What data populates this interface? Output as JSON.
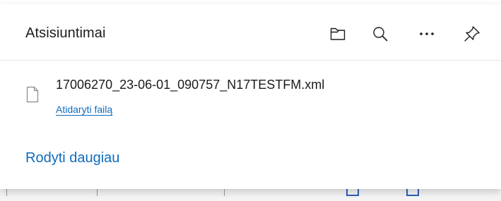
{
  "panel": {
    "title": "Atsisiuntimai",
    "header_icons": [
      "folder-icon",
      "search-icon",
      "more-icon",
      "pin-icon"
    ]
  },
  "downloads": [
    {
      "file_name": "17006270_23-06-01_090757_N17TESTFM.xml",
      "action_label": "Atidaryti failą",
      "icon": "file-icon"
    }
  ],
  "footer": {
    "show_more_label": "Rodyti daugiau"
  },
  "colors": {
    "link": "#0f6cbd",
    "text": "#1b1b1b",
    "panel_bg": "#ffffff"
  }
}
